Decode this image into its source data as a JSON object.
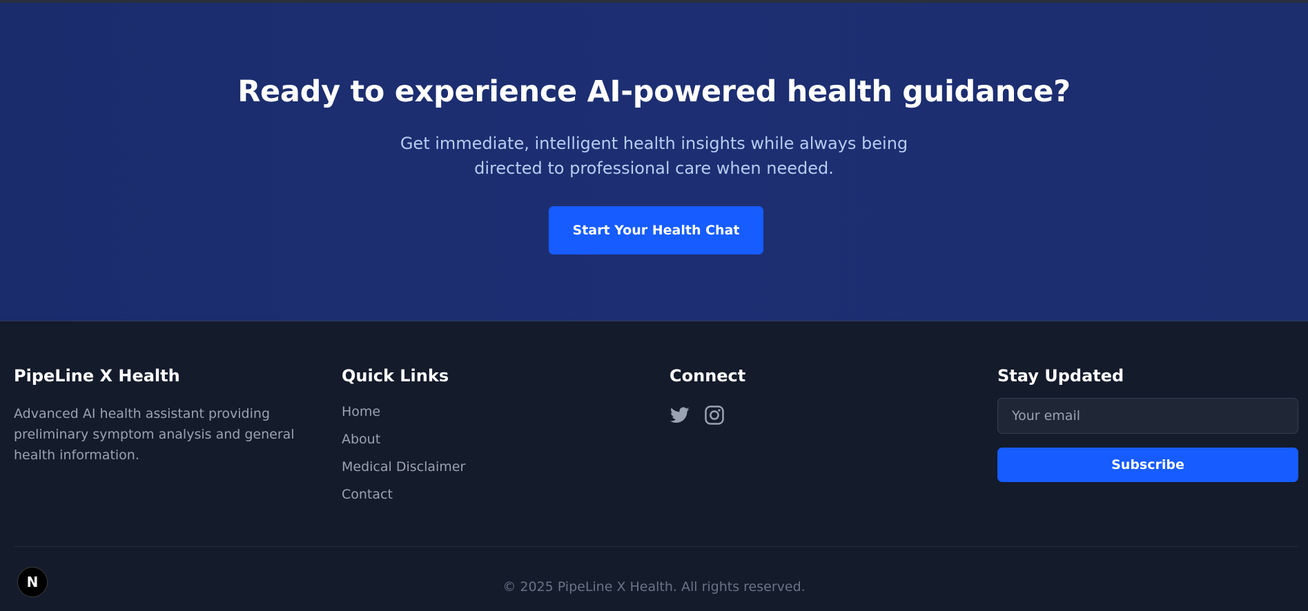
{
  "cta": {
    "title": "Ready to experience AI-powered health guidance?",
    "subtitle": "Get immediate, intelligent health insights while always being directed to professional care when needed.",
    "button_label": "Start Your Health Chat"
  },
  "footer": {
    "brand": {
      "title": "PipeLine X Health",
      "description": "Advanced AI health assistant providing preliminary symptom analysis and general health information."
    },
    "quick_links": {
      "title": "Quick Links",
      "items": [
        {
          "label": "Home"
        },
        {
          "label": "About"
        },
        {
          "label": "Medical Disclaimer"
        },
        {
          "label": "Contact"
        }
      ]
    },
    "connect": {
      "title": "Connect",
      "icons": [
        "twitter-icon",
        "instagram-icon"
      ]
    },
    "newsletter": {
      "title": "Stay Updated",
      "email_placeholder": "Your email",
      "email_value": "",
      "button_label": "Subscribe"
    },
    "copyright": "© 2025 PipeLine X Health. All rights reserved.",
    "badge_letter": "N"
  },
  "colors": {
    "cta_background": "#1c2e6e",
    "footer_background": "#141b2b",
    "accent": "#165cff",
    "muted_text": "#9aa3b2"
  }
}
